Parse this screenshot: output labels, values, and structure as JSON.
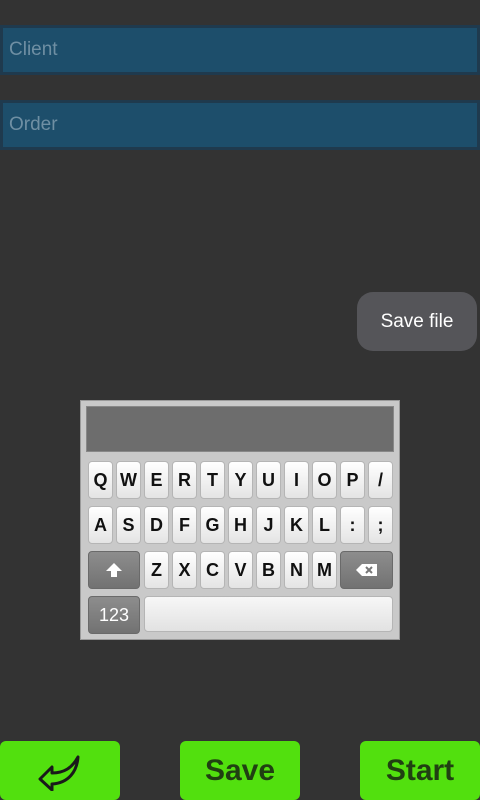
{
  "form": {
    "client_placeholder": "Client",
    "order_placeholder": "Order"
  },
  "toast": {
    "label": "Save file"
  },
  "keyboard": {
    "row1": [
      "Q",
      "W",
      "E",
      "R",
      "T",
      "Y",
      "U",
      "I",
      "O",
      "P",
      "/"
    ],
    "row2": [
      "A",
      "S",
      "D",
      "F",
      "G",
      "H",
      "J",
      "K",
      "L",
      ":",
      ";"
    ],
    "row3": [
      "Z",
      "X",
      "C",
      "V",
      "B",
      "N",
      "M"
    ],
    "mode_label": "123",
    "shift_icon": "arrow-up-icon",
    "backspace_icon": "backspace-icon"
  },
  "bottom_bar": {
    "back_icon": "back-arrow-icon",
    "save_label": "Save",
    "start_label": "Start",
    "color": "#52e00e"
  }
}
